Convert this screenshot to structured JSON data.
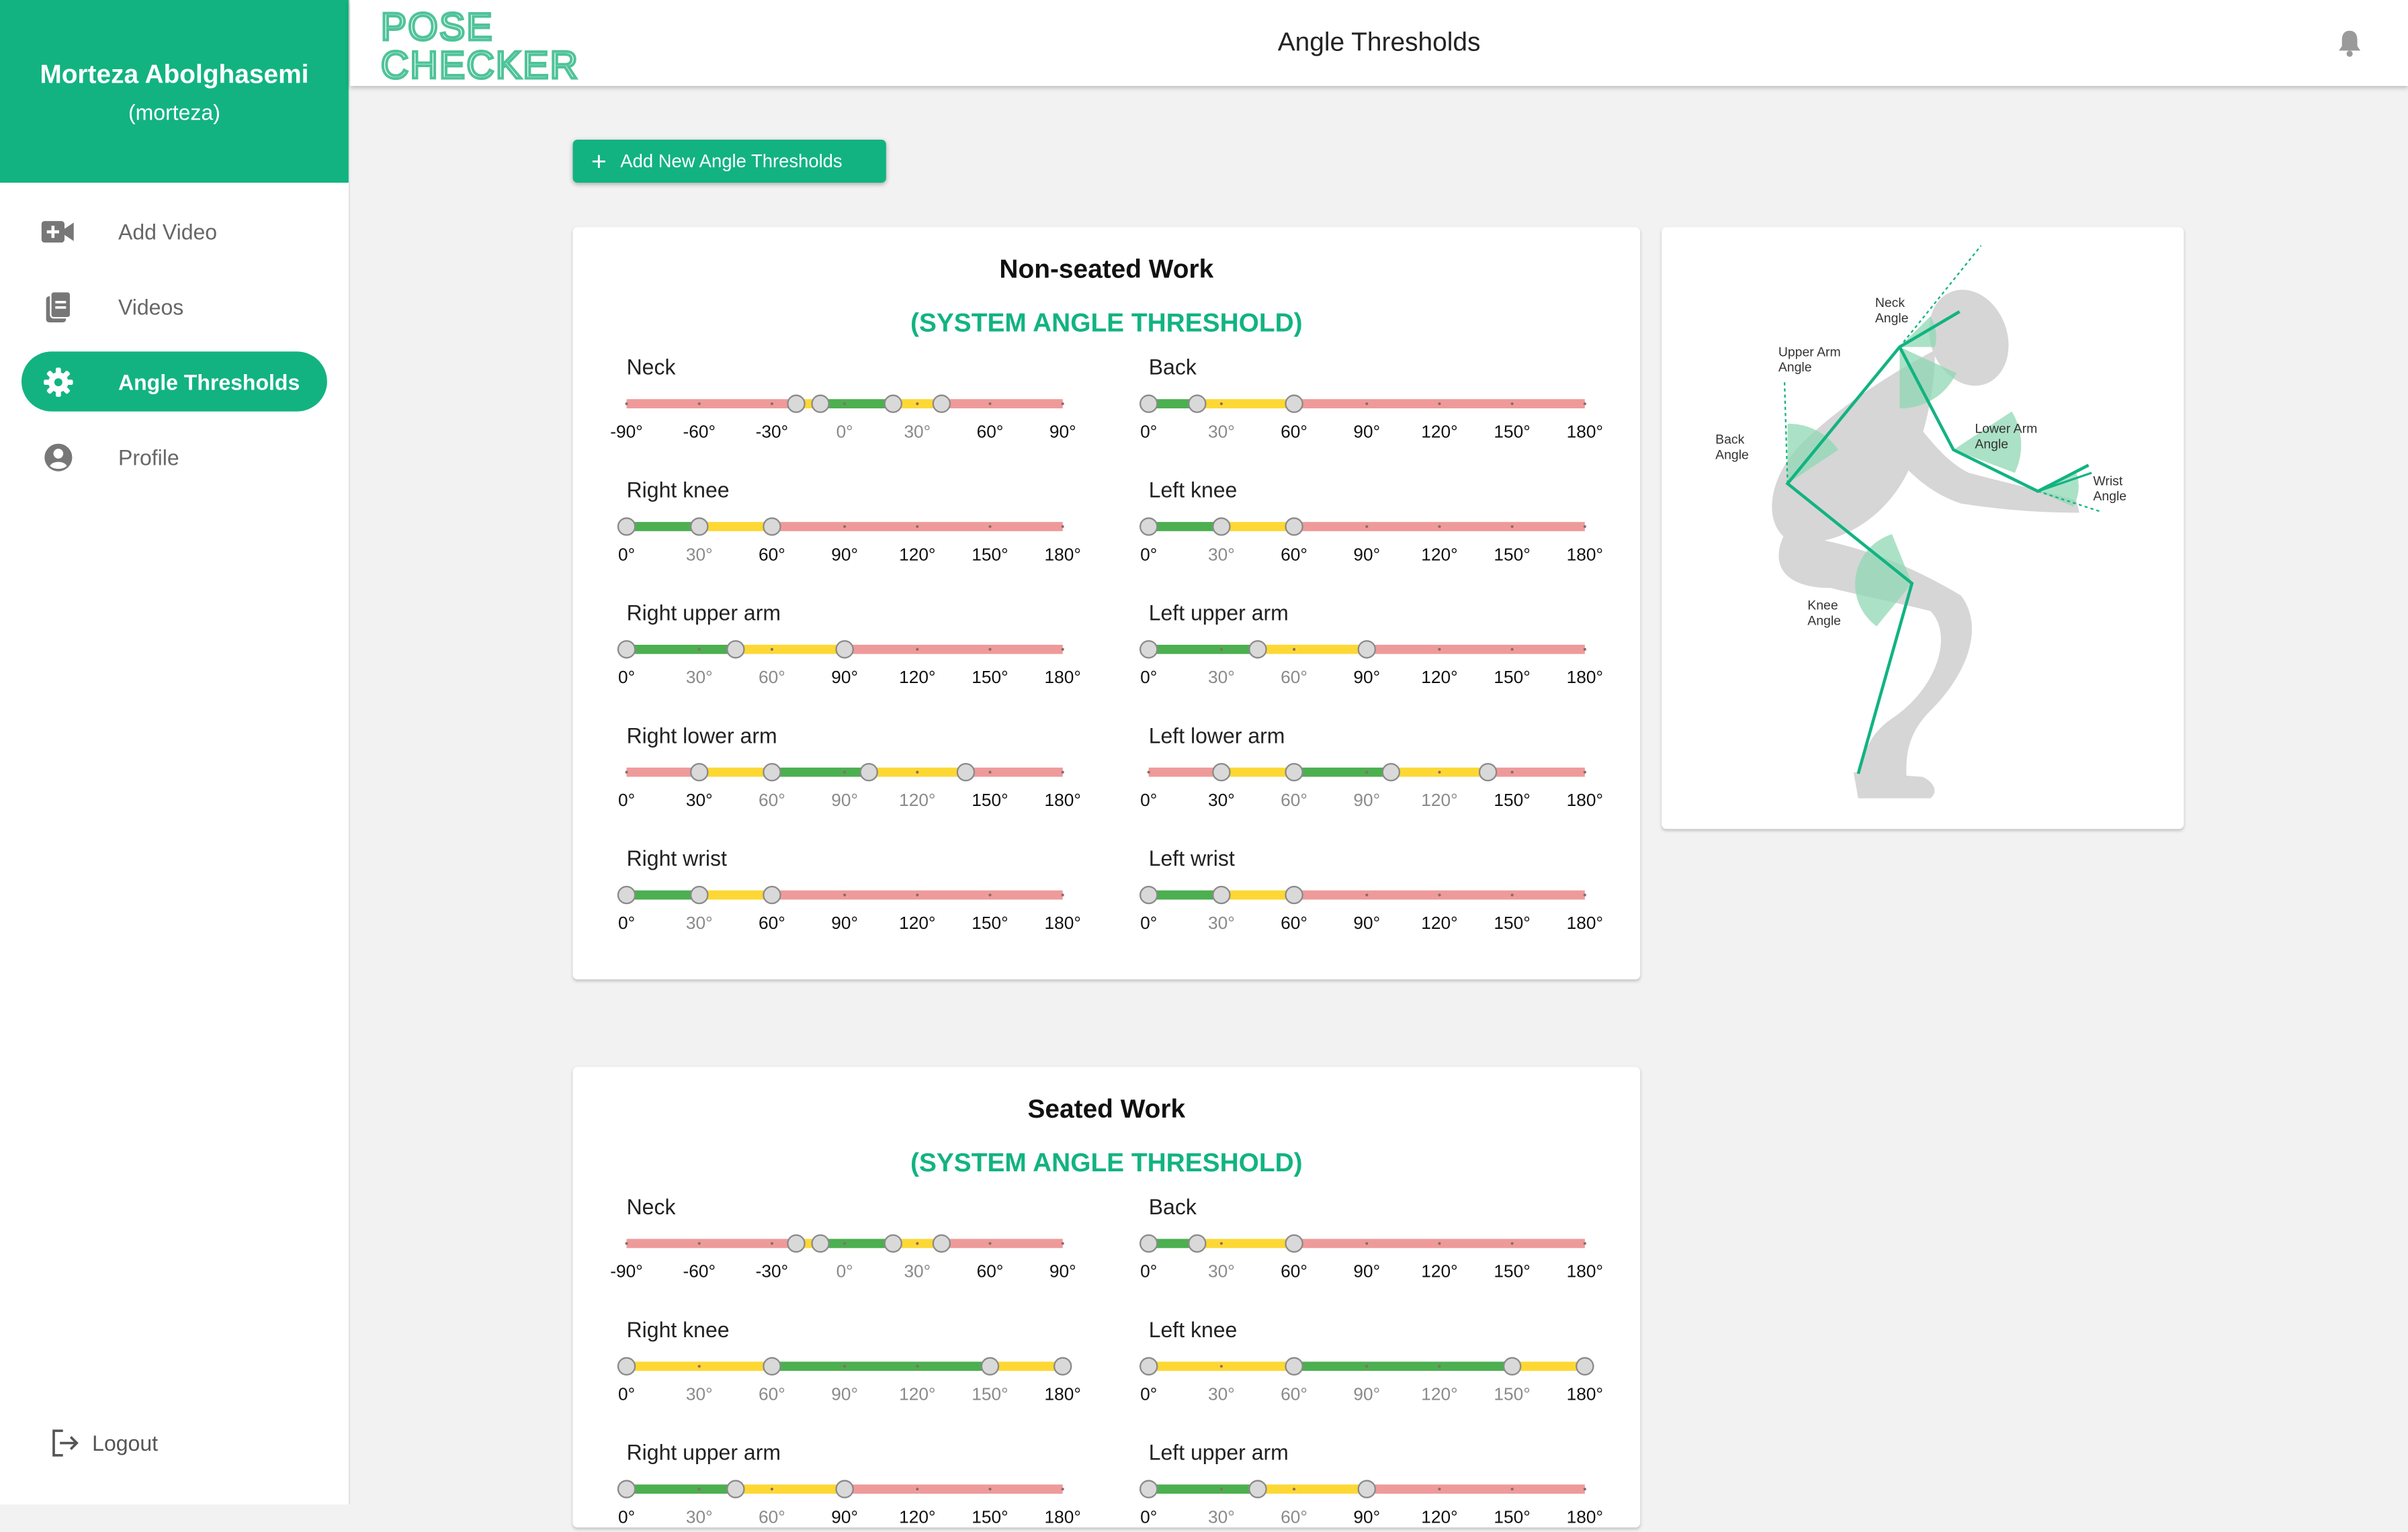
{
  "user": {
    "name": "Morteza Abolghasemi",
    "username": "(morteza)"
  },
  "nav": [
    {
      "label": "Add Video",
      "icon": "video-add-icon",
      "active": false
    },
    {
      "label": "Videos",
      "icon": "videos-library-icon",
      "active": false
    },
    {
      "label": "Angle Thresholds",
      "icon": "gear-icon",
      "active": true
    },
    {
      "label": "Profile",
      "icon": "account-circle-icon",
      "active": false
    }
  ],
  "logout_label": "Logout",
  "logo": {
    "line1": "POSE",
    "line2": "CHECKER"
  },
  "header": {
    "title": "Angle Thresholds"
  },
  "add_button_label": "Add New Angle Thresholds",
  "colors": {
    "primary": "#12b381",
    "green": "#4caf50",
    "yellow": "#fdd835",
    "red": "#ef9a9a",
    "thumb": "#d9d9d9"
  },
  "cards": [
    {
      "title": "Non-seated Work",
      "subtitle": "(SYSTEM ANGLE THRESHOLD)",
      "sliders": [
        {
          "label": "Neck",
          "min": -90,
          "max": 90,
          "segments": [
            [
              -90,
              -20,
              "red"
            ],
            [
              -20,
              -10,
              "yellow"
            ],
            [
              -10,
              20,
              "green"
            ],
            [
              20,
              40,
              "yellow"
            ],
            [
              40,
              90,
              "red"
            ]
          ],
          "thumbs": [
            -20,
            -10,
            20,
            40
          ],
          "ticks": [
            "-90°",
            "-60°",
            "-30°",
            "0°",
            "30°",
            "60°",
            "90°"
          ],
          "tick_emphasis": [
            1,
            1,
            1,
            0,
            0,
            1,
            1
          ]
        },
        {
          "label": "Back",
          "min": 0,
          "max": 180,
          "segments": [
            [
              0,
              20,
              "green"
            ],
            [
              20,
              60,
              "yellow"
            ],
            [
              60,
              180,
              "red"
            ]
          ],
          "thumbs": [
            0,
            20,
            60
          ],
          "ticks": [
            "0°",
            "30°",
            "60°",
            "90°",
            "120°",
            "150°",
            "180°"
          ],
          "tick_emphasis": [
            1,
            0,
            1,
            1,
            1,
            1,
            1
          ]
        },
        {
          "label": "Right knee",
          "min": 0,
          "max": 180,
          "segments": [
            [
              0,
              30,
              "green"
            ],
            [
              30,
              60,
              "yellow"
            ],
            [
              60,
              180,
              "red"
            ]
          ],
          "thumbs": [
            0,
            30,
            60
          ],
          "ticks": [
            "0°",
            "30°",
            "60°",
            "90°",
            "120°",
            "150°",
            "180°"
          ],
          "tick_emphasis": [
            1,
            0,
            1,
            1,
            1,
            1,
            1
          ]
        },
        {
          "label": "Left knee",
          "min": 0,
          "max": 180,
          "segments": [
            [
              0,
              30,
              "green"
            ],
            [
              30,
              60,
              "yellow"
            ],
            [
              60,
              180,
              "red"
            ]
          ],
          "thumbs": [
            0,
            30,
            60
          ],
          "ticks": [
            "0°",
            "30°",
            "60°",
            "90°",
            "120°",
            "150°",
            "180°"
          ],
          "tick_emphasis": [
            1,
            0,
            1,
            1,
            1,
            1,
            1
          ]
        },
        {
          "label": "Right upper arm",
          "min": 0,
          "max": 180,
          "segments": [
            [
              0,
              45,
              "green"
            ],
            [
              45,
              90,
              "yellow"
            ],
            [
              90,
              180,
              "red"
            ]
          ],
          "thumbs": [
            0,
            45,
            90
          ],
          "ticks": [
            "0°",
            "30°",
            "60°",
            "90°",
            "120°",
            "150°",
            "180°"
          ],
          "tick_emphasis": [
            1,
            0,
            0,
            1,
            1,
            1,
            1
          ]
        },
        {
          "label": "Left upper arm",
          "min": 0,
          "max": 180,
          "segments": [
            [
              0,
              45,
              "green"
            ],
            [
              45,
              90,
              "yellow"
            ],
            [
              90,
              180,
              "red"
            ]
          ],
          "thumbs": [
            0,
            45,
            90
          ],
          "ticks": [
            "0°",
            "30°",
            "60°",
            "90°",
            "120°",
            "150°",
            "180°"
          ],
          "tick_emphasis": [
            1,
            0,
            0,
            1,
            1,
            1,
            1
          ]
        },
        {
          "label": "Right lower arm",
          "min": 0,
          "max": 180,
          "segments": [
            [
              0,
              30,
              "red"
            ],
            [
              30,
              60,
              "yellow"
            ],
            [
              60,
              100,
              "green"
            ],
            [
              100,
              140,
              "yellow"
            ],
            [
              140,
              180,
              "red"
            ]
          ],
          "thumbs": [
            30,
            60,
            100,
            140
          ],
          "ticks": [
            "0°",
            "30°",
            "60°",
            "90°",
            "120°",
            "150°",
            "180°"
          ],
          "tick_emphasis": [
            1,
            1,
            0,
            0,
            0,
            1,
            1
          ]
        },
        {
          "label": "Left lower arm",
          "min": 0,
          "max": 180,
          "segments": [
            [
              0,
              30,
              "red"
            ],
            [
              30,
              60,
              "yellow"
            ],
            [
              60,
              100,
              "green"
            ],
            [
              100,
              140,
              "yellow"
            ],
            [
              140,
              180,
              "red"
            ]
          ],
          "thumbs": [
            30,
            60,
            100,
            140
          ],
          "ticks": [
            "0°",
            "30°",
            "60°",
            "90°",
            "120°",
            "150°",
            "180°"
          ],
          "tick_emphasis": [
            1,
            1,
            0,
            0,
            0,
            1,
            1
          ]
        },
        {
          "label": "Right wrist",
          "min": 0,
          "max": 180,
          "segments": [
            [
              0,
              30,
              "green"
            ],
            [
              30,
              60,
              "yellow"
            ],
            [
              60,
              180,
              "red"
            ]
          ],
          "thumbs": [
            0,
            30,
            60
          ],
          "ticks": [
            "0°",
            "30°",
            "60°",
            "90°",
            "120°",
            "150°",
            "180°"
          ],
          "tick_emphasis": [
            1,
            0,
            1,
            1,
            1,
            1,
            1
          ]
        },
        {
          "label": "Left wrist",
          "min": 0,
          "max": 180,
          "segments": [
            [
              0,
              30,
              "green"
            ],
            [
              30,
              60,
              "yellow"
            ],
            [
              60,
              180,
              "red"
            ]
          ],
          "thumbs": [
            0,
            30,
            60
          ],
          "ticks": [
            "0°",
            "30°",
            "60°",
            "90°",
            "120°",
            "150°",
            "180°"
          ],
          "tick_emphasis": [
            1,
            0,
            1,
            1,
            1,
            1,
            1
          ]
        }
      ]
    },
    {
      "title": "Seated Work",
      "subtitle": "(SYSTEM ANGLE THRESHOLD)",
      "sliders": [
        {
          "label": "Neck",
          "min": -90,
          "max": 90,
          "segments": [
            [
              -90,
              -20,
              "red"
            ],
            [
              -20,
              -10,
              "yellow"
            ],
            [
              -10,
              20,
              "green"
            ],
            [
              20,
              40,
              "yellow"
            ],
            [
              40,
              90,
              "red"
            ]
          ],
          "thumbs": [
            -20,
            -10,
            20,
            40
          ],
          "ticks": [
            "-90°",
            "-60°",
            "-30°",
            "0°",
            "30°",
            "60°",
            "90°"
          ],
          "tick_emphasis": [
            1,
            1,
            1,
            0,
            0,
            1,
            1
          ]
        },
        {
          "label": "Back",
          "min": 0,
          "max": 180,
          "segments": [
            [
              0,
              20,
              "green"
            ],
            [
              20,
              60,
              "yellow"
            ],
            [
              60,
              180,
              "red"
            ]
          ],
          "thumbs": [
            0,
            20,
            60
          ],
          "ticks": [
            "0°",
            "30°",
            "60°",
            "90°",
            "120°",
            "150°",
            "180°"
          ],
          "tick_emphasis": [
            1,
            0,
            1,
            1,
            1,
            1,
            1
          ]
        },
        {
          "label": "Right knee",
          "min": 0,
          "max": 180,
          "segments": [
            [
              0,
              60,
              "yellow"
            ],
            [
              60,
              150,
              "green"
            ],
            [
              150,
              180,
              "yellow"
            ]
          ],
          "thumbs": [
            0,
            60,
            150,
            180
          ],
          "ticks": [
            "0°",
            "30°",
            "60°",
            "90°",
            "120°",
            "150°",
            "180°"
          ],
          "tick_emphasis": [
            1,
            0,
            0,
            0,
            0,
            0,
            1
          ]
        },
        {
          "label": "Left knee",
          "min": 0,
          "max": 180,
          "segments": [
            [
              0,
              60,
              "yellow"
            ],
            [
              60,
              150,
              "green"
            ],
            [
              150,
              180,
              "yellow"
            ]
          ],
          "thumbs": [
            0,
            60,
            150,
            180
          ],
          "ticks": [
            "0°",
            "30°",
            "60°",
            "90°",
            "120°",
            "150°",
            "180°"
          ],
          "tick_emphasis": [
            1,
            0,
            0,
            0,
            0,
            0,
            1
          ]
        },
        {
          "label": "Right upper arm",
          "min": 0,
          "max": 180,
          "segments": [
            [
              0,
              45,
              "green"
            ],
            [
              45,
              90,
              "yellow"
            ],
            [
              90,
              180,
              "red"
            ]
          ],
          "thumbs": [
            0,
            45,
            90
          ],
          "ticks": [
            "0°",
            "30°",
            "60°",
            "90°",
            "120°",
            "150°",
            "180°"
          ],
          "tick_emphasis": [
            1,
            0,
            0,
            1,
            1,
            1,
            1
          ]
        },
        {
          "label": "Left upper arm",
          "min": 0,
          "max": 180,
          "segments": [
            [
              0,
              45,
              "green"
            ],
            [
              45,
              90,
              "yellow"
            ],
            [
              90,
              180,
              "red"
            ]
          ],
          "thumbs": [
            0,
            45,
            90
          ],
          "ticks": [
            "0°",
            "30°",
            "60°",
            "90°",
            "120°",
            "150°",
            "180°"
          ],
          "tick_emphasis": [
            1,
            0,
            0,
            1,
            1,
            1,
            1
          ]
        }
      ]
    }
  ],
  "figure_labels": {
    "neck": [
      "Neck",
      "Angle"
    ],
    "upper_arm": [
      "Upper Arm",
      "Angle"
    ],
    "back": [
      "Back",
      "Angle"
    ],
    "lower_arm": [
      "Lower Arm",
      "Angle"
    ],
    "wrist": [
      "Wrist",
      "Angle"
    ],
    "knee": [
      "Knee",
      "Angle"
    ]
  }
}
